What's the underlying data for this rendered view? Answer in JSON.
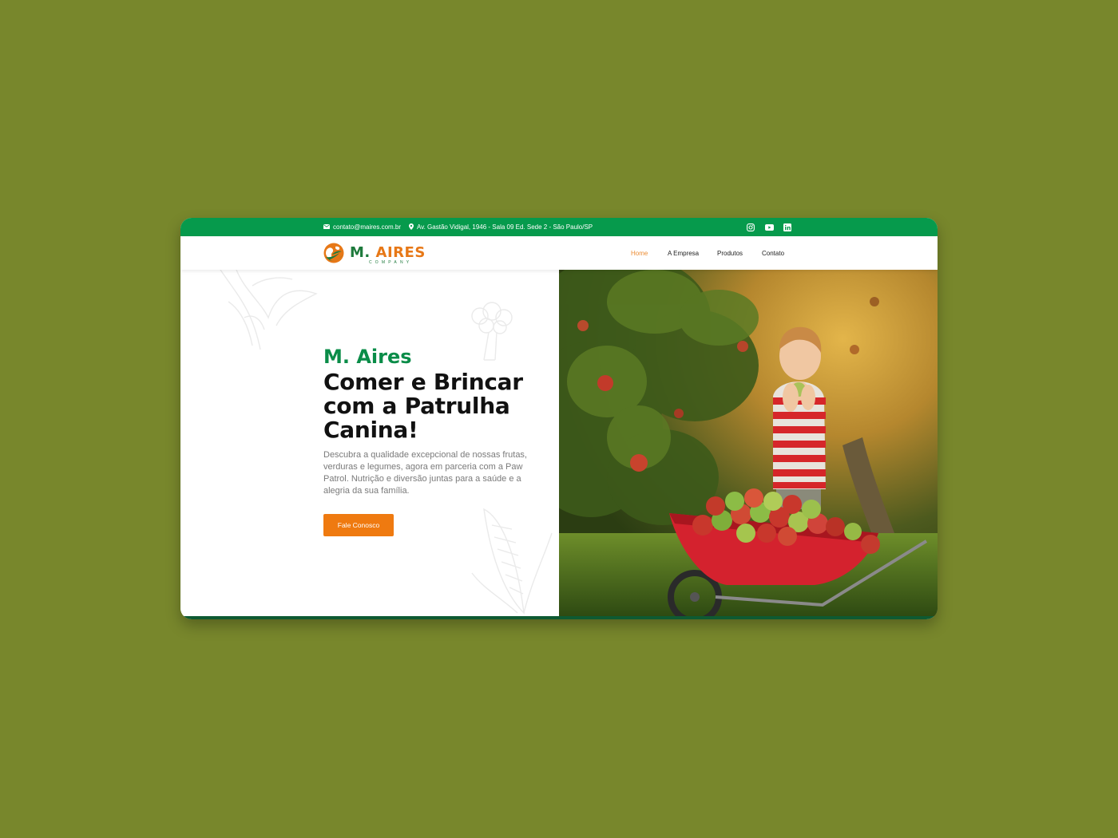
{
  "topbar": {
    "email": "contato@maires.com.br",
    "address": "Av. Gastão Vidigal, 1946 - Sala 09 Ed. Sede 2 - São Paulo/SP",
    "social_icons": [
      "instagram-icon",
      "youtube-icon",
      "linkedin-icon"
    ]
  },
  "logo": {
    "main": "M. ",
    "accent": "AIRES",
    "sub": "COMPANY"
  },
  "nav": {
    "items": [
      {
        "label": "Home",
        "active": true
      },
      {
        "label": "A Empresa",
        "active": false
      },
      {
        "label": "Produtos",
        "active": false
      },
      {
        "label": "Contato",
        "active": false
      }
    ]
  },
  "hero": {
    "brand": "M. Aires",
    "headline": "Comer e Brincar com a Patrulha Canina!",
    "description": "Descubra a qualidade excepcional de nossas frutas, verduras e legumes, agora em parceria com a Paw Patrol. Nutrição e diversão juntas para a saúde e a alegria da sua família.",
    "cta_label": "Fale Conosco"
  },
  "colors": {
    "page_background": "#78872c",
    "topbar_green": "#069a4c",
    "brand_green": "#0a8c48",
    "cta_orange": "#ef7a10",
    "nav_active": "#ec8d33"
  }
}
